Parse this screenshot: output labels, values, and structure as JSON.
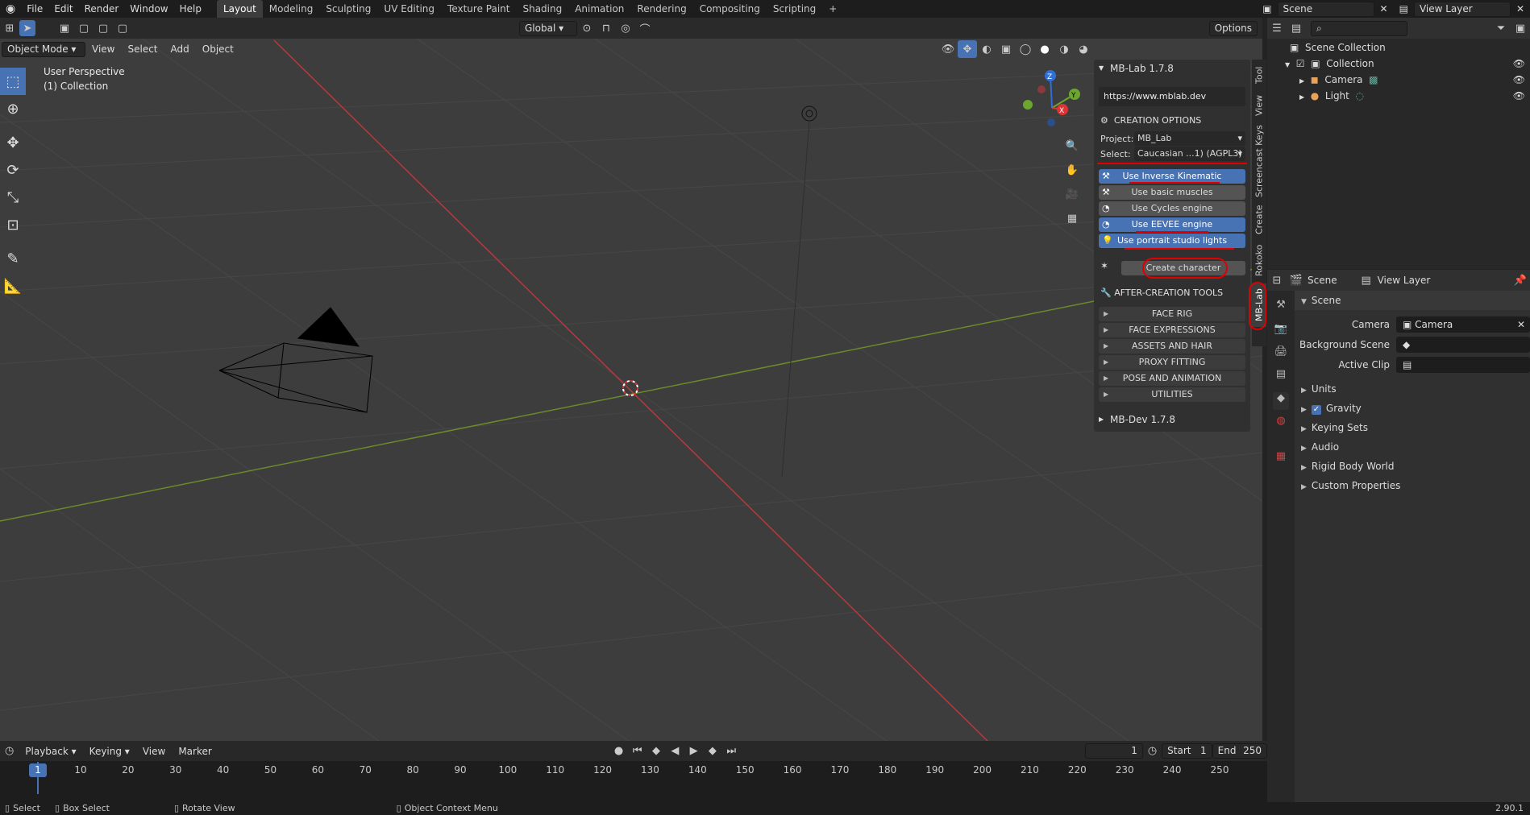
{
  "menu": {
    "items": [
      "File",
      "Edit",
      "Render",
      "Window",
      "Help"
    ]
  },
  "workspaces": [
    "Layout",
    "Modeling",
    "Sculpting",
    "UV Editing",
    "Texture Paint",
    "Shading",
    "Animation",
    "Rendering",
    "Compositing",
    "Scripting"
  ],
  "top_right": {
    "scene_label": "Scene",
    "view_layer_label": "View Layer"
  },
  "viewport_header": {
    "mode": "Object Mode",
    "view": "View",
    "select": "Select",
    "add": "Add",
    "object": "Object",
    "transform": "Global",
    "options": "Options"
  },
  "viewport_overlay": {
    "perspective": "User Perspective",
    "collection": "(1) Collection"
  },
  "mblab": {
    "title": "MB-Lab 1.7.8",
    "url": "https://www.mblab.dev",
    "creation_options": "CREATION OPTIONS",
    "project_label": "Project:",
    "project_value": "MB_Lab",
    "select_label": "Select:",
    "select_value": "Caucasian ...1) (AGPL3)",
    "toggles": [
      {
        "label": "Use Inverse Kinematic",
        "on": true
      },
      {
        "label": "Use basic muscles",
        "on": false
      },
      {
        "label": "Use Cycles engine",
        "on": false
      },
      {
        "label": "Use EEVEE engine",
        "on": true
      },
      {
        "label": "Use portrait studio lights",
        "on": true
      }
    ],
    "create_button": "Create character",
    "after_tools": "AFTER-CREATION TOOLS",
    "subpanels": [
      "FACE RIG",
      "FACE EXPRESSIONS",
      "ASSETS AND HAIR",
      "PROXY FITTING",
      "POSE AND ANIMATION",
      "UTILITIES"
    ],
    "mbdev": "MB-Dev 1.7.8"
  },
  "vtabs": [
    "Tool",
    "View",
    "Screencast Keys",
    "Create",
    "Rokoko",
    "MB-Lab"
  ],
  "timeline": {
    "playback": "Playback",
    "keying": "Keying",
    "view": "View",
    "marker": "Marker",
    "current_frame": "1",
    "start_label": "Start",
    "start": "1",
    "end_label": "End",
    "end": "250",
    "ticks": [
      "1",
      "10",
      "20",
      "30",
      "40",
      "50",
      "60",
      "70",
      "80",
      "90",
      "100",
      "110",
      "120",
      "130",
      "140",
      "150",
      "160",
      "170",
      "180",
      "190",
      "200",
      "210",
      "220",
      "230",
      "240",
      "250"
    ]
  },
  "status": {
    "select": "Select",
    "box_select": "Box Select",
    "rotate": "Rotate View",
    "context": "Object Context Menu",
    "version": "2.90.1"
  },
  "outliner": {
    "root": "Scene Collection",
    "collection": "Collection",
    "camera": "Camera",
    "light": "Light"
  },
  "properties": {
    "scene_tab": "Scene",
    "view_layer_tab": "View Layer",
    "panel": "Scene",
    "camera_label": "Camera",
    "camera_value": "Camera",
    "bg_label": "Background Scene",
    "clip_label": "Active Clip",
    "sections": [
      "Units",
      "Gravity",
      "Keying Sets",
      "Audio",
      "Rigid Body World",
      "Custom Properties"
    ]
  }
}
